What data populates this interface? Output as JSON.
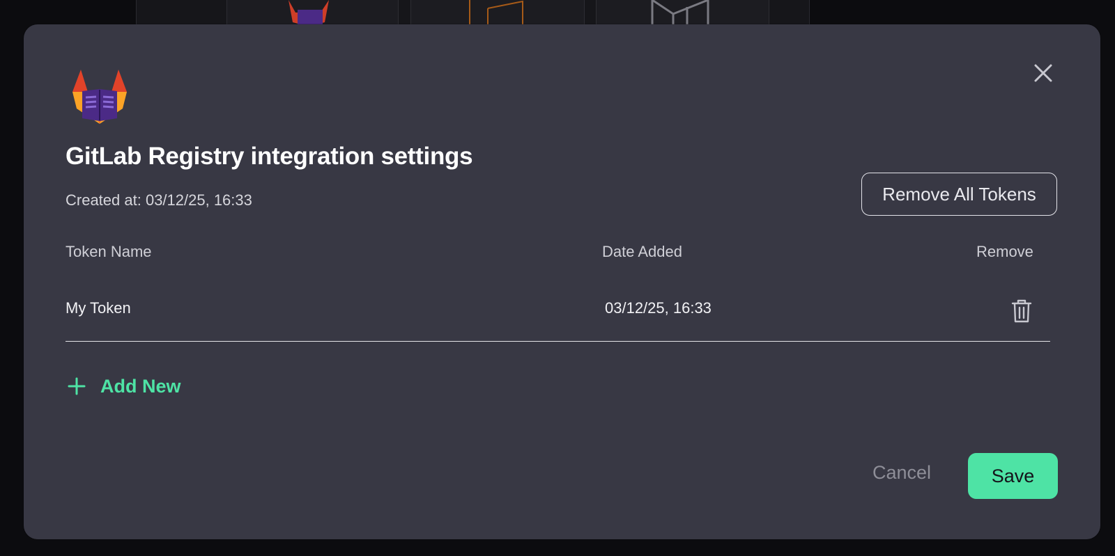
{
  "dialog": {
    "title": "GitLab Registry integration settings",
    "created_at": "Created at: 03/12/25, 16:33",
    "remove_all_label": "Remove All Tokens",
    "logo_icon": "gitlab-registry-logo",
    "close_icon": "close-icon"
  },
  "table": {
    "columns": [
      "Token Name",
      "Date Added",
      "Remove"
    ],
    "rows": [
      {
        "name": "My Token",
        "date_added": "03/12/25, 16:33",
        "remove_icon": "trash-icon"
      }
    ]
  },
  "add_new": {
    "label": "Add New",
    "icon": "plus-icon"
  },
  "footer": {
    "cancel_label": "Cancel",
    "save_label": "Save"
  },
  "colors": {
    "accent": "#4ee3a5",
    "modal_bg": "#383844",
    "page_bg": "#0c0c0f"
  }
}
